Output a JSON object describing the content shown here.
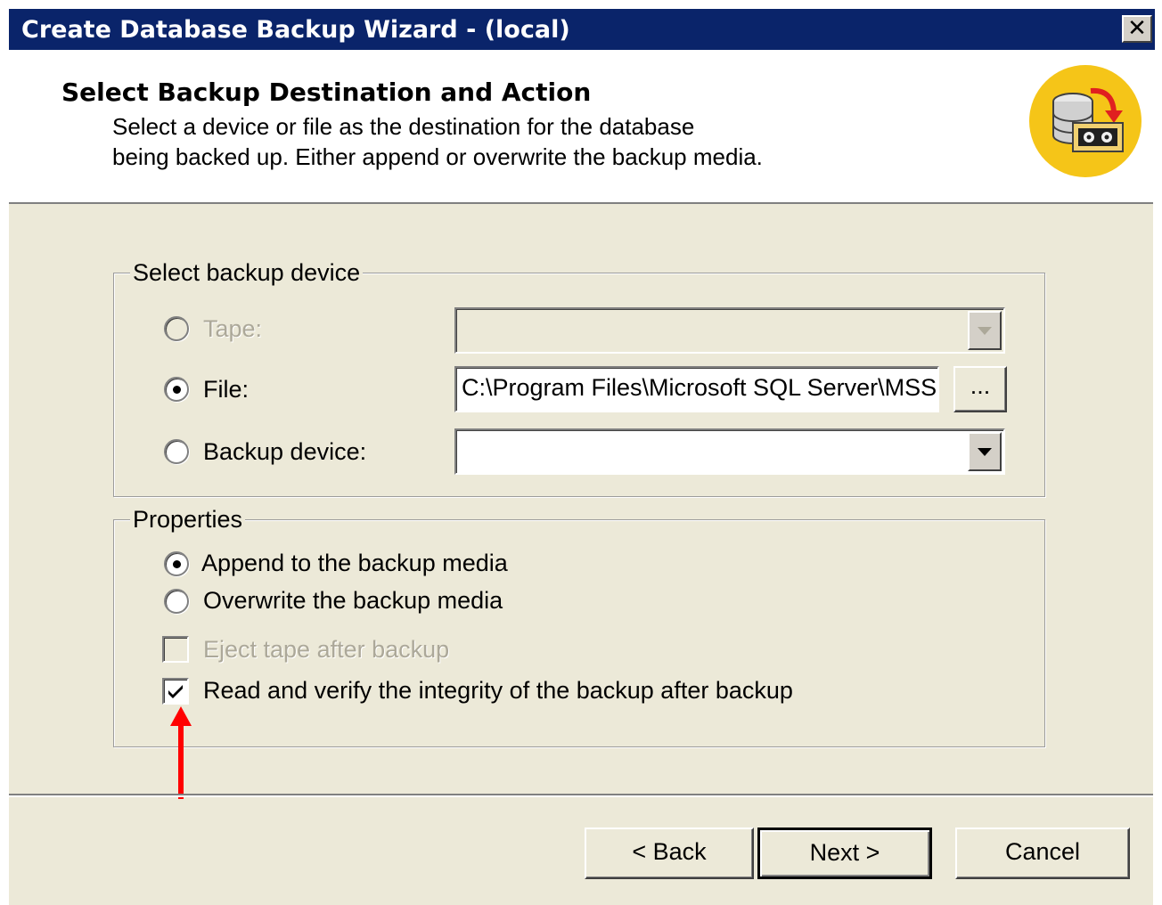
{
  "window": {
    "title": "Create Database Backup Wizard - (local)",
    "close_glyph": "✕"
  },
  "header": {
    "title": "Select Backup Destination and Action",
    "description_line1": "Select a device or file as the destination for the database",
    "description_line2": "being backed up. Either append or overwrite the backup media.",
    "icon": "database-backup-icon"
  },
  "backup_device_group": {
    "legend": "Select backup device",
    "options": [
      {
        "label": "Tape:",
        "selected": false,
        "enabled": false,
        "value": ""
      },
      {
        "label": "File:",
        "selected": true,
        "enabled": true,
        "value": "C:\\Program Files\\Microsoft SQL Server\\MSSQL"
      },
      {
        "label": "Backup device:",
        "selected": false,
        "enabled": true,
        "value": ""
      }
    ],
    "browse_label": "..."
  },
  "properties_group": {
    "legend": "Properties",
    "append_label": "Append to the backup media",
    "append_selected": true,
    "overwrite_label": "Overwrite the backup media",
    "overwrite_selected": false,
    "eject_label": "Eject tape after backup",
    "eject_checked": false,
    "eject_enabled": false,
    "verify_label": "Read and verify the integrity of the backup after backup",
    "verify_checked": true
  },
  "annotation": {
    "arrow_color": "#ff0000"
  },
  "buttons": {
    "back": "< Back",
    "next": "Next >",
    "cancel": "Cancel"
  },
  "colors": {
    "titlebar": "#0a246a",
    "dialog_bg": "#ece9d8",
    "header_bg": "#ffffff"
  }
}
